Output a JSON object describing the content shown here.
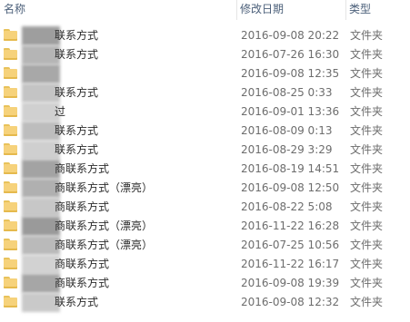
{
  "columns": {
    "name": "名称",
    "date_modified": "修改日期",
    "type": "类型"
  },
  "rows": [
    {
      "name_suffix": "联系方式",
      "date": "2016-09-08 20:22",
      "type": "文件夹",
      "blur": "#9e9e9e"
    },
    {
      "name_suffix": "联系方式",
      "date": "2016-07-26 16:30",
      "type": "文件夹",
      "blur": "#b5b5b5"
    },
    {
      "name_suffix": "",
      "date": "2016-09-08 12:35",
      "type": "文件夹",
      "blur": "#a8a8a8"
    },
    {
      "name_suffix": "联系方式",
      "date": "2016-08-25 0:33",
      "type": "文件夹",
      "blur": "#c4c4c4"
    },
    {
      "name_suffix": "过",
      "date": "2016-09-01 13:36",
      "type": "文件夹",
      "blur": "#d0d0d0"
    },
    {
      "name_suffix": "联系方式",
      "date": "2016-08-09 0:13",
      "type": "文件夹",
      "blur": "#bdbdbd"
    },
    {
      "name_suffix": "联系方式",
      "date": "2016-08-29 3:29",
      "type": "文件夹",
      "blur": "#cfcfcf"
    },
    {
      "name_suffix": "商联系方式",
      "date": "2016-08-19 14:51",
      "type": "文件夹",
      "blur": "#a3a3a3"
    },
    {
      "name_suffix": "商联系方式（漂亮）",
      "date": "2016-09-08 12:50",
      "type": "文件夹",
      "blur": "#b0b0b0"
    },
    {
      "name_suffix": "商联系方式",
      "date": "2016-08-22 5:08",
      "type": "文件夹",
      "blur": "#c7c7c7"
    },
    {
      "name_suffix": "商联系方式（漂亮）",
      "date": "2016-11-22 16:28",
      "type": "文件夹",
      "blur": "#9a9a9a"
    },
    {
      "name_suffix": "商联系方式（漂亮）",
      "date": "2016-07-25 10:56",
      "type": "文件夹",
      "blur": "#bababa"
    },
    {
      "name_suffix": "商联系方式",
      "date": "2016-11-22 16:17",
      "type": "文件夹",
      "blur": "#d2d2d2"
    },
    {
      "name_suffix": "商联系方式",
      "date": "2016-09-08 19:39",
      "type": "文件夹",
      "blur": "#a6a6a6"
    },
    {
      "name_suffix": "联系方式",
      "date": "2016-09-08 12:32",
      "type": "文件夹",
      "blur": "#c9c9c9"
    }
  ]
}
